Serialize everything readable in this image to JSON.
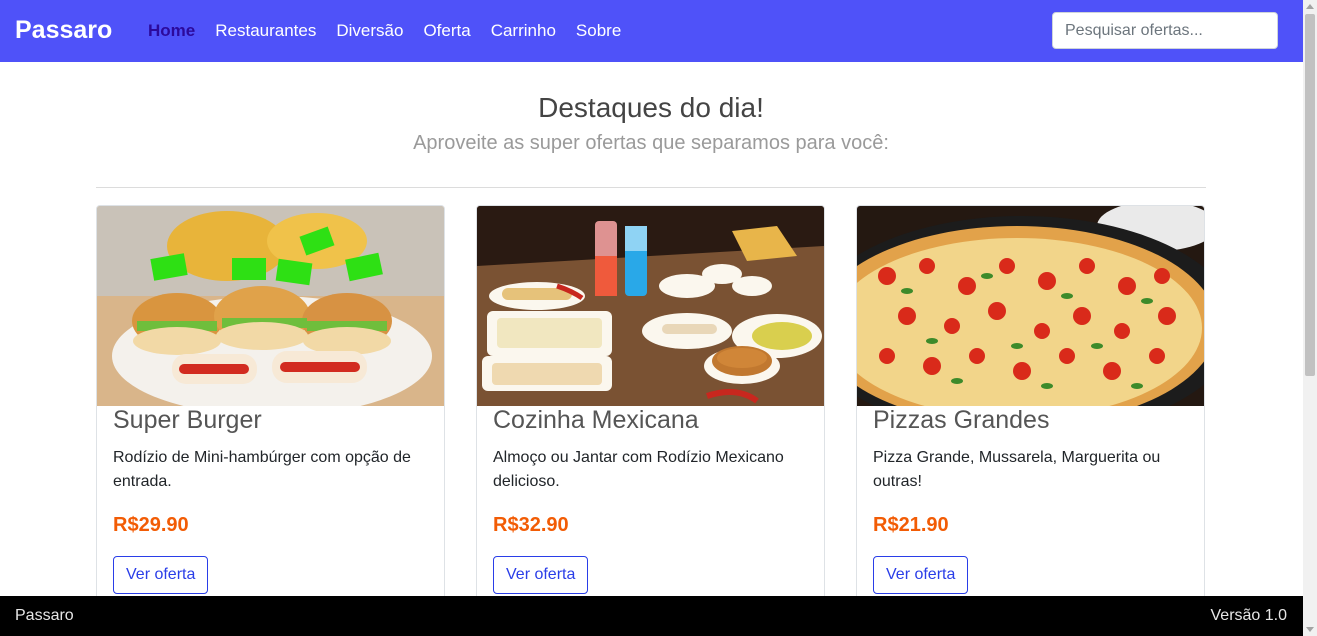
{
  "navbar": {
    "brand": "Passaro",
    "links": [
      "Home",
      "Restaurantes",
      "Diversão",
      "Oferta",
      "Carrinho",
      "Sobre"
    ],
    "active": "Home",
    "search_placeholder": "Pesquisar ofertas...",
    "background": "#4f52f9"
  },
  "hero": {
    "title": "Destaques do dia!",
    "subtitle": "Aproveite as super ofertas que separamos para você:"
  },
  "cards": [
    {
      "title": "Super Burger",
      "description": "Rodízio de Mini-hambúrger com opção de entrada.",
      "price": "R$29.90",
      "button": "Ver oferta",
      "image": "burger-photo"
    },
    {
      "title": "Cozinha Mexicana",
      "description": "Almoço ou Jantar com Rodízio Mexicano delicioso.",
      "price": "R$32.90",
      "button": "Ver oferta",
      "image": "mexican-food-photo"
    },
    {
      "title": "Pizzas Grandes",
      "description": "Pizza Grande, Mussarela, Marguerita ou outras!",
      "price": "R$21.90",
      "button": "Ver oferta",
      "image": "pizza-photo"
    }
  ],
  "footer": {
    "left": "Passaro",
    "right": "Versão 1.0"
  },
  "colors": {
    "price": "#f25c05",
    "button": "#2a3ee8",
    "footer_bg": "#000000"
  }
}
